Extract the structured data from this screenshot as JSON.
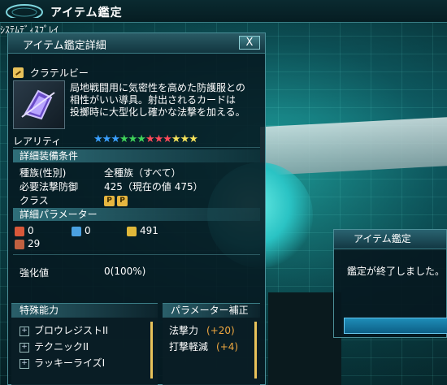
{
  "window_title": "アイテム鑑定",
  "top_deco_text": "ｼｽﾃﾑﾃﾞｨｽﾌﾟﾚｲ",
  "detail_panel": {
    "title": "アイテム鑑定詳細",
    "close_label": "X",
    "item_name": "クラテルビー",
    "description": "局地戦闘用に気密性を高めた防護服との\n相性がいい導具。射出されるカードは\n投擲時に大型化し確かな法撃を加える。",
    "rarity_label": "レアリティ",
    "rarity_stars": [
      {
        "color": "#3aa0ff"
      },
      {
        "color": "#3aa0ff"
      },
      {
        "color": "#3aa0ff"
      },
      {
        "color": "#3fd35a"
      },
      {
        "color": "#3fd35a"
      },
      {
        "color": "#3fd35a"
      },
      {
        "color": "#ff4a5a"
      },
      {
        "color": "#ff4a5a"
      },
      {
        "color": "#ff4a5a"
      },
      {
        "color": "#f6e35a"
      },
      {
        "color": "#f6e35a"
      },
      {
        "color": "#f6e35a"
      }
    ],
    "section_requirements": "詳細装備条件",
    "requirements": [
      {
        "key": "種族(性別)",
        "value": "全種族（すべて）"
      },
      {
        "key": "必要法撃防御",
        "value": "425（現在の値 475）"
      },
      {
        "key": "クラス",
        "value": ""
      }
    ],
    "class_badges": [
      "P",
      "P"
    ],
    "section_params": "詳細パラメーター",
    "params": [
      {
        "icon": "strike-icon",
        "value": "0",
        "color": "#d8583a"
      },
      {
        "icon": "range-icon",
        "value": "0",
        "color": "#4aa0e0"
      },
      {
        "icon": "tech-icon",
        "value": "491",
        "color": "#e0b83a"
      },
      {
        "icon": "dex-icon",
        "value": "29",
        "color": "#c06040"
      }
    ],
    "grind_label": "強化値",
    "grind_value": "0(100%)",
    "special_title": "特殊能力",
    "special_abilities": [
      "ブロウレジストII",
      "テクニックII",
      "ラッキーライズI"
    ],
    "param_bonus_title": "パラメーター補正",
    "param_bonus": [
      {
        "key": "法撃力",
        "value": "(+20)"
      },
      {
        "key": "打撃軽減",
        "value": "(+4)"
      }
    ]
  },
  "dialog": {
    "title": "アイテム鑑定",
    "message": "鑑定が終了しました。"
  }
}
